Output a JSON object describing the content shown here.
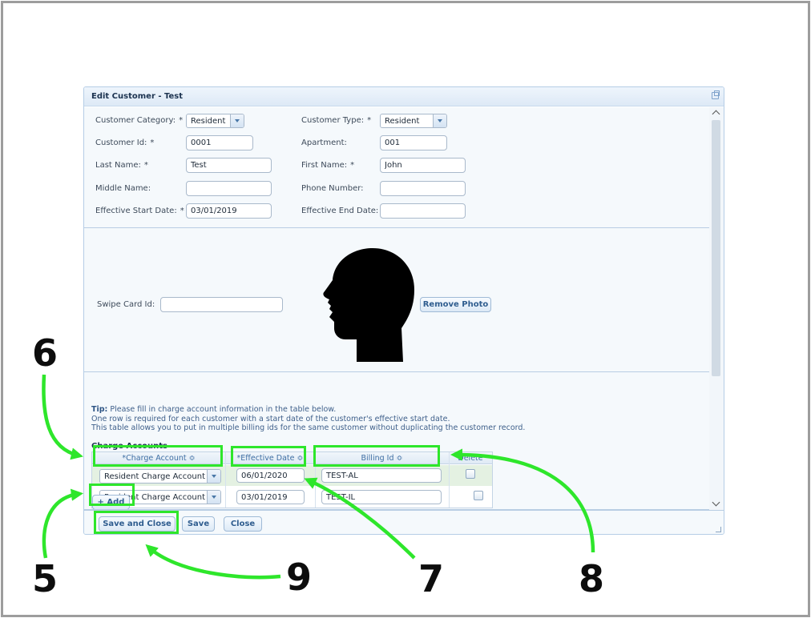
{
  "dialog": {
    "title": "Edit Customer - Test"
  },
  "form": {
    "customer_category": {
      "label": "Customer Category:",
      "required": "*",
      "value": "Resident"
    },
    "customer_type": {
      "label": "Customer Type:",
      "required": "*",
      "value": "Resident"
    },
    "customer_id": {
      "label": "Customer Id:",
      "required": "*",
      "value": "0001"
    },
    "apartment": {
      "label": "Apartment:",
      "value": "001"
    },
    "last_name": {
      "label": "Last Name:",
      "required": "*",
      "value": "Test"
    },
    "first_name": {
      "label": "First Name:",
      "required": "*",
      "value": "John"
    },
    "middle_name": {
      "label": "Middle Name:",
      "value": ""
    },
    "phone_number": {
      "label": "Phone Number:",
      "value": ""
    },
    "effective_start_date": {
      "label": "Effective Start Date:",
      "required": "*",
      "value": "03/01/2019"
    },
    "effective_end_date": {
      "label": "Effective End Date:",
      "value": ""
    },
    "swipe_card_id": {
      "label": "Swipe Card Id:",
      "value": ""
    },
    "remove_photo_label": "Remove Photo"
  },
  "tip": {
    "prefix": "Tip:",
    "line1": "Please fill in charge account information in the table below.",
    "line2": "One row is required for each customer with a start date of the customer's effective start date.",
    "line3": "This table allows you to put in multiple billing ids for the same customer without duplicating the customer record."
  },
  "charge_accounts": {
    "section_title": "Charge Accounts",
    "columns": [
      "*Charge Account ≎",
      "*Effective Date ≎",
      "Billing Id ≎",
      "Delete"
    ],
    "rows": [
      {
        "account": "Resident Charge Account",
        "date": "06/01/2020",
        "billing_id": "TEST-AL"
      },
      {
        "account": "Resident Charge Account",
        "date": "03/01/2019",
        "billing_id": "TEST-IL"
      }
    ],
    "add_label": "Add"
  },
  "footer": {
    "save_close_label": "Save and Close",
    "save_label": "Save",
    "close_label": "Close"
  },
  "annotations": {
    "n5": "5",
    "n6": "6",
    "n7": "7",
    "n8": "8",
    "n9": "9",
    "highlight_color": "#2ee62b"
  }
}
